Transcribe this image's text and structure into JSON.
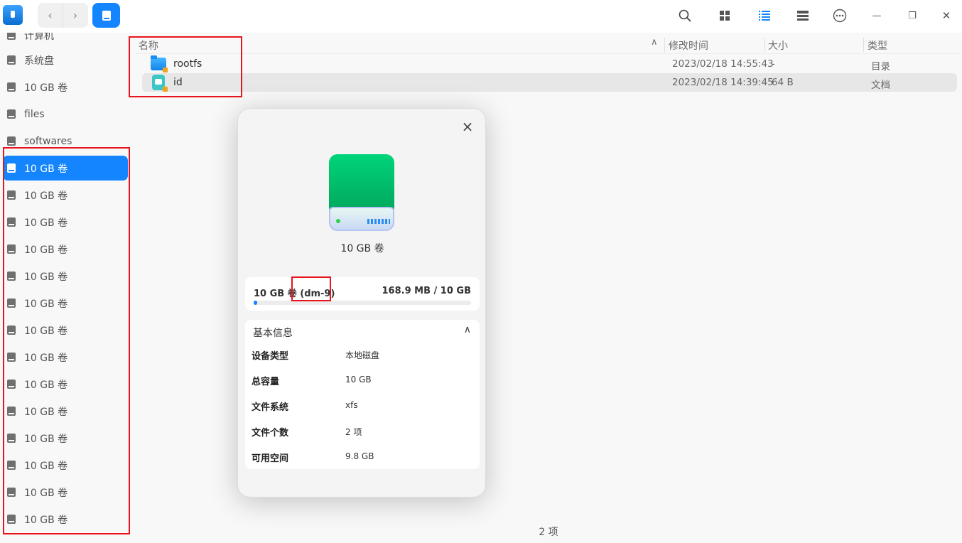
{
  "toolbar": {
    "back_icon": "‹",
    "forward_icon": "›",
    "search_icon": "search-icon",
    "icon_view": "grid-icon",
    "list_view": "list-icon",
    "detail_view": "details-icon",
    "menu": "more-icon",
    "minimize": "—",
    "restore": "❐",
    "close": "✕"
  },
  "sidebar": {
    "items": [
      {
        "label": "计算机"
      },
      {
        "label": "系统盘"
      },
      {
        "label": "10 GB 卷"
      },
      {
        "label": "files"
      },
      {
        "label": "softwares"
      },
      {
        "label": "10 GB 卷",
        "active": true
      },
      {
        "label": "10 GB 卷"
      },
      {
        "label": "10 GB 卷"
      },
      {
        "label": "10 GB 卷"
      },
      {
        "label": "10 GB 卷"
      },
      {
        "label": "10 GB 卷"
      },
      {
        "label": "10 GB 卷"
      },
      {
        "label": "10 GB 卷"
      },
      {
        "label": "10 GB 卷"
      },
      {
        "label": "10 GB 卷"
      },
      {
        "label": "10 GB 卷"
      },
      {
        "label": "10 GB 卷"
      },
      {
        "label": "10 GB 卷"
      },
      {
        "label": "10 GB 卷"
      }
    ]
  },
  "table": {
    "headers": {
      "name": "名称",
      "modified": "修改时间",
      "size": "大小",
      "type": "类型"
    },
    "sort_icon": "∧",
    "rows": [
      {
        "name": "rootfs",
        "modified": "2023/02/18 14:55:43",
        "size": "-",
        "type": "目录"
      },
      {
        "name": "id",
        "modified": "2023/02/18 14:39:45",
        "size": "64 B",
        "type": "文档"
      }
    ]
  },
  "status": {
    "count": "2 项"
  },
  "dialog": {
    "close_icon": "×",
    "title": "10 GB 卷",
    "usage": {
      "label": "10 GB 卷 (dm-9)",
      "value": "168.9 MB / 10 GB",
      "fraction": 0.017
    },
    "section_title": "基本信息",
    "chevron": "∧",
    "info": [
      {
        "key": "设备类型",
        "value": "本地磁盘"
      },
      {
        "key": "总容量",
        "value": "10 GB"
      },
      {
        "key": "文件系统",
        "value": "xfs"
      },
      {
        "key": "文件个数",
        "value": "2 项"
      },
      {
        "key": "可用空间",
        "value": "9.8 GB"
      }
    ]
  },
  "colors": {
    "accent": "#1485ff",
    "highlight": "#e8141b"
  }
}
